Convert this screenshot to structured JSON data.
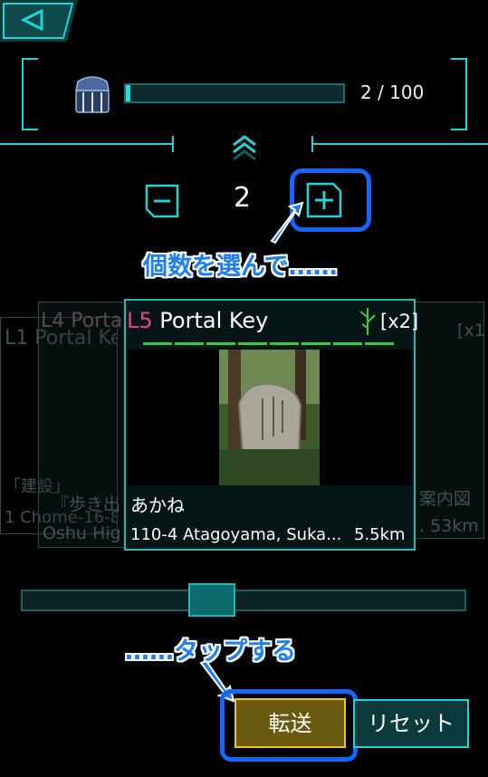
{
  "nav": {
    "back_label": "◁"
  },
  "capsule": {
    "count_text": "2 / 100",
    "fill_fraction": 0.02
  },
  "quantity": {
    "value": "2"
  },
  "annotations": {
    "select_count": "個数を選んで……",
    "tap": "……タップする"
  },
  "ghost_cards": {
    "far_left": {
      "title": "L1 Portal Ke",
      "line1": "「建設」",
      "line2": "1 Chome-16-8"
    },
    "left": {
      "title": "L4 Portal",
      "line1": "『歩き出",
      "line2": "Oshu Hig"
    },
    "right": {
      "mult": "[x1]",
      "line1": "案内図",
      "line2": ". 53km"
    }
  },
  "card": {
    "level": "L5",
    "title": "Portal Key",
    "multiplier": "[x2]",
    "name": "あかね",
    "address": "110-4 Atagoyama, Suka...",
    "distance": "5.5km",
    "resonator_count": 8
  },
  "slider": {
    "position_fraction": 0.42
  },
  "buttons": {
    "transfer": "転送",
    "reset": "リセット"
  },
  "colors": {
    "accent": "#1fd4d4",
    "level": "#e84393",
    "resonator": "#37c846",
    "transfer_border": "#f2c515",
    "highlight": "#1565ff"
  }
}
